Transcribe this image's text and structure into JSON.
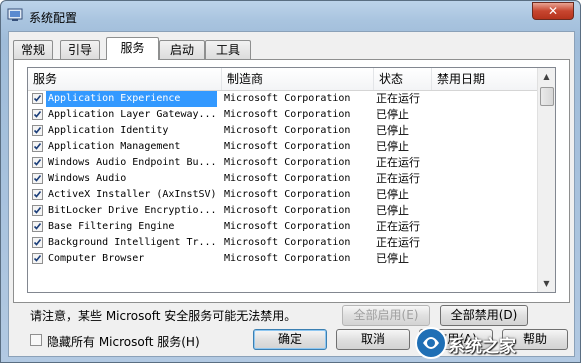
{
  "window": {
    "title": "系统配置",
    "close_glyph": "✕"
  },
  "tabs": [
    {
      "label": "常规",
      "active": false
    },
    {
      "label": "引导",
      "active": false
    },
    {
      "label": "服务",
      "active": true
    },
    {
      "label": "启动",
      "active": false
    },
    {
      "label": "工具",
      "active": false
    }
  ],
  "columns": {
    "name": "服务",
    "manufacturer": "制造商",
    "status": "状态",
    "disabled_date": "禁用日期"
  },
  "services": [
    {
      "checked": true,
      "name": "Application Experience",
      "manufacturer": "Microsoft Corporation",
      "status": "正在运行",
      "date": "",
      "selected": true
    },
    {
      "checked": true,
      "name": "Application Layer Gateway...",
      "manufacturer": "Microsoft Corporation",
      "status": "已停止",
      "date": ""
    },
    {
      "checked": true,
      "name": "Application Identity",
      "manufacturer": "Microsoft Corporation",
      "status": "已停止",
      "date": ""
    },
    {
      "checked": true,
      "name": "Application Management",
      "manufacturer": "Microsoft Corporation",
      "status": "已停止",
      "date": ""
    },
    {
      "checked": true,
      "name": "Windows Audio Endpoint Bu...",
      "manufacturer": "Microsoft Corporation",
      "status": "正在运行",
      "date": ""
    },
    {
      "checked": true,
      "name": "Windows Audio",
      "manufacturer": "Microsoft Corporation",
      "status": "正在运行",
      "date": ""
    },
    {
      "checked": true,
      "name": "ActiveX Installer (AxInstSV)",
      "manufacturer": "Microsoft Corporation",
      "status": "已停止",
      "date": ""
    },
    {
      "checked": true,
      "name": "BitLocker Drive Encryptio...",
      "manufacturer": "Microsoft Corporation",
      "status": "已停止",
      "date": ""
    },
    {
      "checked": true,
      "name": "Base Filtering Engine",
      "manufacturer": "Microsoft Corporation",
      "status": "正在运行",
      "date": ""
    },
    {
      "checked": true,
      "name": "Background Intelligent Tr...",
      "manufacturer": "Microsoft Corporation",
      "status": "正在运行",
      "date": ""
    },
    {
      "checked": true,
      "name": "Computer Browser",
      "manufacturer": "Microsoft Corporation",
      "status": "已停止",
      "date": ""
    }
  ],
  "note": "请注意，某些 Microsoft 安全服务可能无法禁用。",
  "buttons": {
    "enable_all": "全部启用(E)",
    "disable_all": "全部禁用(D)",
    "ok": "确定",
    "cancel": "取消",
    "apply": "应用(A)",
    "help": "帮助"
  },
  "hide_ms": {
    "label": "隐藏所有 Microsoft 服务(H)",
    "checked": false
  },
  "watermark": {
    "text": "系统之家"
  },
  "colors": {
    "selection": "#3399ff",
    "title_bar": "#a9c4df",
    "close_button": "#c7452f"
  }
}
